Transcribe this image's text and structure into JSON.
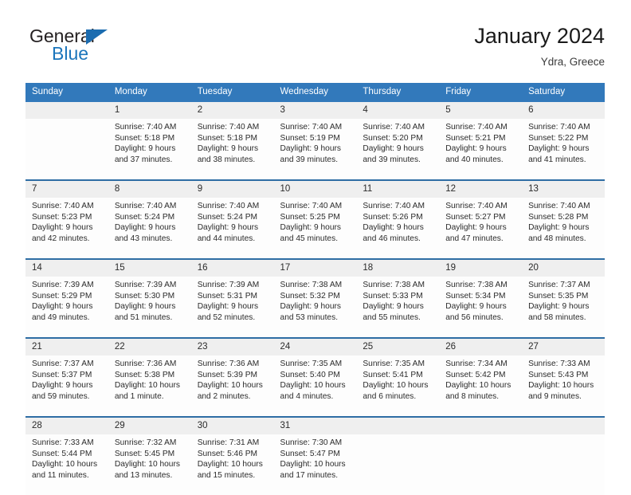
{
  "brand": {
    "name_top": "General",
    "name_bottom": "Blue",
    "color_dark": "#231f20",
    "color_blue": "#1b75bb",
    "flag_icon": "triangle-flag-icon"
  },
  "header": {
    "title": "January 2024",
    "subtitle": "Ydra, Greece"
  },
  "theme": {
    "header_bar": "#3279bb",
    "row_separator": "#2e6da4",
    "daynum_band": "#efefef",
    "cell_bg": "#fdfdfd",
    "text": "#2b2b2b"
  },
  "weekdays": [
    "Sunday",
    "Monday",
    "Tuesday",
    "Wednesday",
    "Thursday",
    "Friday",
    "Saturday"
  ],
  "labels": {
    "sunrise": "Sunrise:",
    "sunset": "Sunset:",
    "daylight": "Daylight:"
  },
  "weeks": [
    {
      "days": [
        {
          "num": "",
          "sunrise": "",
          "sunset": "",
          "daylight_1": "",
          "daylight_2": ""
        },
        {
          "num": "1",
          "sunrise": "Sunrise: 7:40 AM",
          "sunset": "Sunset: 5:18 PM",
          "daylight_1": "Daylight: 9 hours",
          "daylight_2": "and 37 minutes."
        },
        {
          "num": "2",
          "sunrise": "Sunrise: 7:40 AM",
          "sunset": "Sunset: 5:18 PM",
          "daylight_1": "Daylight: 9 hours",
          "daylight_2": "and 38 minutes."
        },
        {
          "num": "3",
          "sunrise": "Sunrise: 7:40 AM",
          "sunset": "Sunset: 5:19 PM",
          "daylight_1": "Daylight: 9 hours",
          "daylight_2": "and 39 minutes."
        },
        {
          "num": "4",
          "sunrise": "Sunrise: 7:40 AM",
          "sunset": "Sunset: 5:20 PM",
          "daylight_1": "Daylight: 9 hours",
          "daylight_2": "and 39 minutes."
        },
        {
          "num": "5",
          "sunrise": "Sunrise: 7:40 AM",
          "sunset": "Sunset: 5:21 PM",
          "daylight_1": "Daylight: 9 hours",
          "daylight_2": "and 40 minutes."
        },
        {
          "num": "6",
          "sunrise": "Sunrise: 7:40 AM",
          "sunset": "Sunset: 5:22 PM",
          "daylight_1": "Daylight: 9 hours",
          "daylight_2": "and 41 minutes."
        }
      ]
    },
    {
      "days": [
        {
          "num": "7",
          "sunrise": "Sunrise: 7:40 AM",
          "sunset": "Sunset: 5:23 PM",
          "daylight_1": "Daylight: 9 hours",
          "daylight_2": "and 42 minutes."
        },
        {
          "num": "8",
          "sunrise": "Sunrise: 7:40 AM",
          "sunset": "Sunset: 5:24 PM",
          "daylight_1": "Daylight: 9 hours",
          "daylight_2": "and 43 minutes."
        },
        {
          "num": "9",
          "sunrise": "Sunrise: 7:40 AM",
          "sunset": "Sunset: 5:24 PM",
          "daylight_1": "Daylight: 9 hours",
          "daylight_2": "and 44 minutes."
        },
        {
          "num": "10",
          "sunrise": "Sunrise: 7:40 AM",
          "sunset": "Sunset: 5:25 PM",
          "daylight_1": "Daylight: 9 hours",
          "daylight_2": "and 45 minutes."
        },
        {
          "num": "11",
          "sunrise": "Sunrise: 7:40 AM",
          "sunset": "Sunset: 5:26 PM",
          "daylight_1": "Daylight: 9 hours",
          "daylight_2": "and 46 minutes."
        },
        {
          "num": "12",
          "sunrise": "Sunrise: 7:40 AM",
          "sunset": "Sunset: 5:27 PM",
          "daylight_1": "Daylight: 9 hours",
          "daylight_2": "and 47 minutes."
        },
        {
          "num": "13",
          "sunrise": "Sunrise: 7:40 AM",
          "sunset": "Sunset: 5:28 PM",
          "daylight_1": "Daylight: 9 hours",
          "daylight_2": "and 48 minutes."
        }
      ]
    },
    {
      "days": [
        {
          "num": "14",
          "sunrise": "Sunrise: 7:39 AM",
          "sunset": "Sunset: 5:29 PM",
          "daylight_1": "Daylight: 9 hours",
          "daylight_2": "and 49 minutes."
        },
        {
          "num": "15",
          "sunrise": "Sunrise: 7:39 AM",
          "sunset": "Sunset: 5:30 PM",
          "daylight_1": "Daylight: 9 hours",
          "daylight_2": "and 51 minutes."
        },
        {
          "num": "16",
          "sunrise": "Sunrise: 7:39 AM",
          "sunset": "Sunset: 5:31 PM",
          "daylight_1": "Daylight: 9 hours",
          "daylight_2": "and 52 minutes."
        },
        {
          "num": "17",
          "sunrise": "Sunrise: 7:38 AM",
          "sunset": "Sunset: 5:32 PM",
          "daylight_1": "Daylight: 9 hours",
          "daylight_2": "and 53 minutes."
        },
        {
          "num": "18",
          "sunrise": "Sunrise: 7:38 AM",
          "sunset": "Sunset: 5:33 PM",
          "daylight_1": "Daylight: 9 hours",
          "daylight_2": "and 55 minutes."
        },
        {
          "num": "19",
          "sunrise": "Sunrise: 7:38 AM",
          "sunset": "Sunset: 5:34 PM",
          "daylight_1": "Daylight: 9 hours",
          "daylight_2": "and 56 minutes."
        },
        {
          "num": "20",
          "sunrise": "Sunrise: 7:37 AM",
          "sunset": "Sunset: 5:35 PM",
          "daylight_1": "Daylight: 9 hours",
          "daylight_2": "and 58 minutes."
        }
      ]
    },
    {
      "days": [
        {
          "num": "21",
          "sunrise": "Sunrise: 7:37 AM",
          "sunset": "Sunset: 5:37 PM",
          "daylight_1": "Daylight: 9 hours",
          "daylight_2": "and 59 minutes."
        },
        {
          "num": "22",
          "sunrise": "Sunrise: 7:36 AM",
          "sunset": "Sunset: 5:38 PM",
          "daylight_1": "Daylight: 10 hours",
          "daylight_2": "and 1 minute."
        },
        {
          "num": "23",
          "sunrise": "Sunrise: 7:36 AM",
          "sunset": "Sunset: 5:39 PM",
          "daylight_1": "Daylight: 10 hours",
          "daylight_2": "and 2 minutes."
        },
        {
          "num": "24",
          "sunrise": "Sunrise: 7:35 AM",
          "sunset": "Sunset: 5:40 PM",
          "daylight_1": "Daylight: 10 hours",
          "daylight_2": "and 4 minutes."
        },
        {
          "num": "25",
          "sunrise": "Sunrise: 7:35 AM",
          "sunset": "Sunset: 5:41 PM",
          "daylight_1": "Daylight: 10 hours",
          "daylight_2": "and 6 minutes."
        },
        {
          "num": "26",
          "sunrise": "Sunrise: 7:34 AM",
          "sunset": "Sunset: 5:42 PM",
          "daylight_1": "Daylight: 10 hours",
          "daylight_2": "and 8 minutes."
        },
        {
          "num": "27",
          "sunrise": "Sunrise: 7:33 AM",
          "sunset": "Sunset: 5:43 PM",
          "daylight_1": "Daylight: 10 hours",
          "daylight_2": "and 9 minutes."
        }
      ]
    },
    {
      "days": [
        {
          "num": "28",
          "sunrise": "Sunrise: 7:33 AM",
          "sunset": "Sunset: 5:44 PM",
          "daylight_1": "Daylight: 10 hours",
          "daylight_2": "and 11 minutes."
        },
        {
          "num": "29",
          "sunrise": "Sunrise: 7:32 AM",
          "sunset": "Sunset: 5:45 PM",
          "daylight_1": "Daylight: 10 hours",
          "daylight_2": "and 13 minutes."
        },
        {
          "num": "30",
          "sunrise": "Sunrise: 7:31 AM",
          "sunset": "Sunset: 5:46 PM",
          "daylight_1": "Daylight: 10 hours",
          "daylight_2": "and 15 minutes."
        },
        {
          "num": "31",
          "sunrise": "Sunrise: 7:30 AM",
          "sunset": "Sunset: 5:47 PM",
          "daylight_1": "Daylight: 10 hours",
          "daylight_2": "and 17 minutes."
        },
        {
          "num": "",
          "sunrise": "",
          "sunset": "",
          "daylight_1": "",
          "daylight_2": ""
        },
        {
          "num": "",
          "sunrise": "",
          "sunset": "",
          "daylight_1": "",
          "daylight_2": ""
        },
        {
          "num": "",
          "sunrise": "",
          "sunset": "",
          "daylight_1": "",
          "daylight_2": ""
        }
      ]
    }
  ]
}
